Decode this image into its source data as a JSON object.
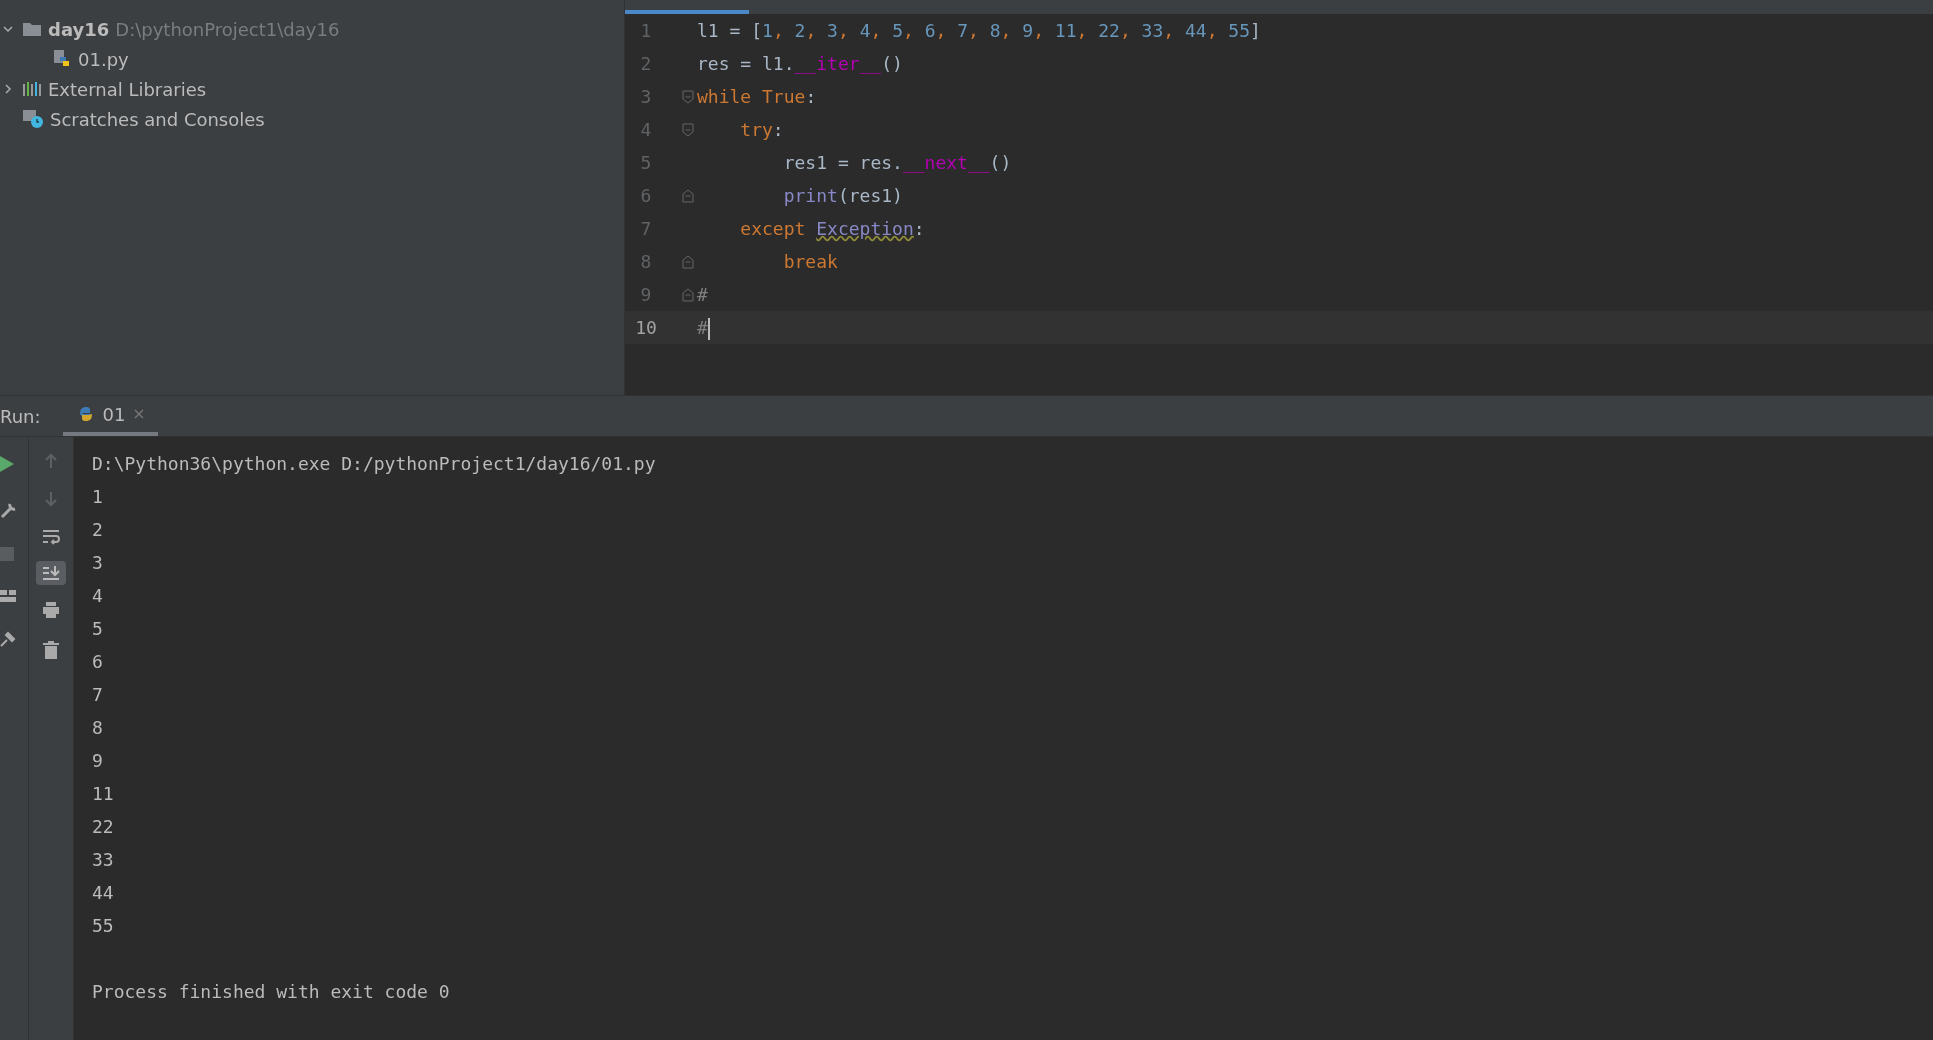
{
  "project_tree": [
    {
      "name": "day16",
      "path": "D:\\pythonProject1\\day16",
      "kind": "folder",
      "expanded": true,
      "children": [
        {
          "name": "01.py",
          "kind": "python"
        }
      ]
    },
    {
      "name": "External Libraries",
      "kind": "libraries",
      "expanded": false
    },
    {
      "name": "Scratches and Consoles",
      "kind": "scratches"
    }
  ],
  "editor": {
    "lines": [
      {
        "number": "1",
        "current": false,
        "kind": "plain",
        "tokens": [
          {
            "text": "l1 = [",
            "kind": "plain"
          },
          {
            "text": "1",
            "kind": "number"
          },
          {
            "text": ", ",
            "kind": "punct"
          },
          {
            "text": "2",
            "kind": "number"
          },
          {
            "text": ", ",
            "kind": "punct"
          },
          {
            "text": "3",
            "kind": "number"
          },
          {
            "text": ", ",
            "kind": "punct"
          },
          {
            "text": "4",
            "kind": "number"
          },
          {
            "text": ", ",
            "kind": "punct"
          },
          {
            "text": "5",
            "kind": "number"
          },
          {
            "text": ", ",
            "kind": "punct"
          },
          {
            "text": "6",
            "kind": "number"
          },
          {
            "text": ", ",
            "kind": "punct"
          },
          {
            "text": "7",
            "kind": "number"
          },
          {
            "text": ", ",
            "kind": "punct"
          },
          {
            "text": "8",
            "kind": "number"
          },
          {
            "text": ", ",
            "kind": "punct"
          },
          {
            "text": "9",
            "kind": "number"
          },
          {
            "text": ", ",
            "kind": "punct"
          },
          {
            "text": "11",
            "kind": "number"
          },
          {
            "text": ", ",
            "kind": "punct"
          },
          {
            "text": "22",
            "kind": "number"
          },
          {
            "text": ", ",
            "kind": "punct"
          },
          {
            "text": "33",
            "kind": "number"
          },
          {
            "text": ", ",
            "kind": "punct"
          },
          {
            "text": "44",
            "kind": "number"
          },
          {
            "text": ", ",
            "kind": "punct"
          },
          {
            "text": "55",
            "kind": "number"
          },
          {
            "text": "]",
            "kind": "plain"
          }
        ]
      },
      {
        "number": "2",
        "current": false,
        "kind": "plain",
        "tokens": [
          {
            "text": "res = l1.",
            "kind": "plain"
          },
          {
            "text": "__iter__",
            "kind": "dunder"
          },
          {
            "text": "()",
            "kind": "plain"
          }
        ]
      },
      {
        "number": "3",
        "current": false,
        "kind": "foldstart",
        "tokens": [
          {
            "text": "while True",
            "kind": "keyword"
          },
          {
            "text": ":",
            "kind": "plain"
          }
        ]
      },
      {
        "number": "4",
        "current": false,
        "kind": "foldstart",
        "tokens": [
          {
            "text": "    try",
            "kind": "keyword"
          },
          {
            "text": ":",
            "kind": "plain"
          }
        ]
      },
      {
        "number": "5",
        "current": false,
        "kind": "plain",
        "tokens": [
          {
            "text": "        res1 = res.",
            "kind": "plain"
          },
          {
            "text": "__next__",
            "kind": "dunder"
          },
          {
            "text": "()",
            "kind": "plain"
          }
        ]
      },
      {
        "number": "6",
        "current": false,
        "kind": "foldend",
        "tokens": [
          {
            "text": "        print",
            "kind": "builtin"
          },
          {
            "text": "(res1)",
            "kind": "plain"
          }
        ]
      },
      {
        "number": "7",
        "current": false,
        "kind": "plain",
        "tokens": [
          {
            "text": "    except ",
            "kind": "keyword"
          },
          {
            "text": "Exception",
            "kind": "class"
          },
          {
            "text": ":",
            "kind": "plain"
          }
        ]
      },
      {
        "number": "8",
        "current": false,
        "kind": "foldend",
        "tokens": [
          {
            "text": "        break",
            "kind": "keyword"
          }
        ]
      },
      {
        "number": "9",
        "current": false,
        "kind": "foldend",
        "tokens": [
          {
            "text": "#",
            "kind": "comment"
          }
        ]
      },
      {
        "number": "10",
        "current": true,
        "kind": "plain",
        "tokens": [
          {
            "text": "#",
            "kind": "comment"
          }
        ]
      }
    ]
  },
  "run": {
    "label": "Run:",
    "tabs": [
      {
        "label": "01",
        "selected": true
      }
    ],
    "console": {
      "lines": [
        "D:\\Python36\\python.exe D:/pythonProject1/day16/01.py",
        "1",
        "2",
        "3",
        "4",
        "5",
        "6",
        "7",
        "8",
        "9",
        "11",
        "22",
        "33",
        "44",
        "55"
      ],
      "status": "Process finished with exit code 0"
    }
  }
}
